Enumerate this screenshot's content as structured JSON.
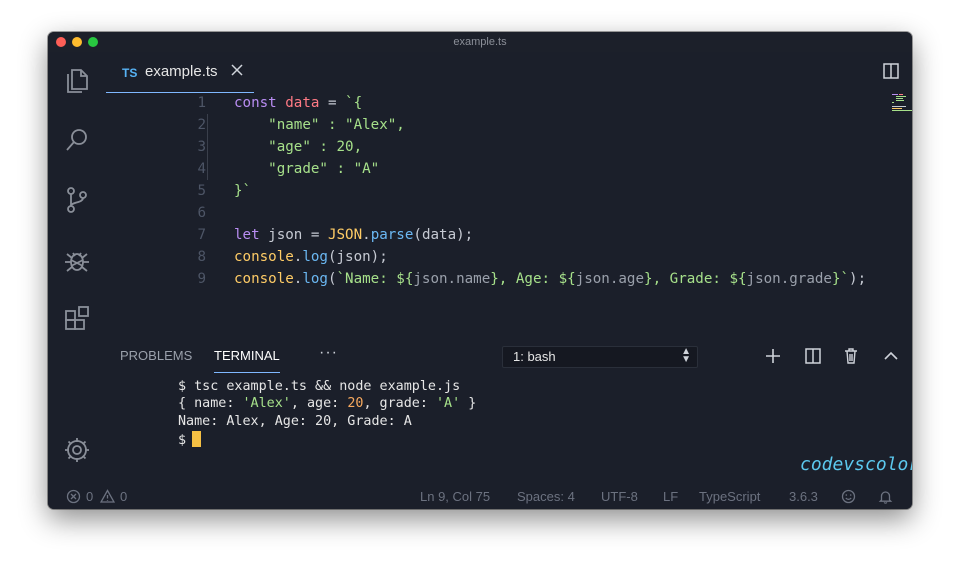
{
  "window": {
    "title": "example.ts"
  },
  "activity_bar": {
    "items": [
      "files-icon",
      "search-icon",
      "source-control-icon",
      "debug-icon",
      "extensions-icon"
    ],
    "bottom": "gear-icon"
  },
  "tab": {
    "lang_badge": "TS",
    "filename": "example.ts"
  },
  "editor": {
    "lines": [
      {
        "num": "1",
        "tokens": [
          [
            "kw",
            "const "
          ],
          [
            "var",
            "data"
          ],
          [
            "punc",
            " = "
          ],
          [
            "tpl",
            "`{"
          ]
        ]
      },
      {
        "num": "2",
        "tokens": [
          [
            "str",
            "    \"name\" : \"Alex\","
          ]
        ]
      },
      {
        "num": "3",
        "tokens": [
          [
            "str",
            "    \"age\" : 20,"
          ]
        ]
      },
      {
        "num": "4",
        "tokens": [
          [
            "str",
            "    \"grade\" : \"A\""
          ]
        ]
      },
      {
        "num": "5",
        "tokens": [
          [
            "tpl",
            "}`"
          ]
        ]
      },
      {
        "num": "6",
        "tokens": []
      },
      {
        "num": "7",
        "tokens": [
          [
            "kw",
            "let "
          ],
          [
            "punc",
            "json = "
          ],
          [
            "obj",
            "JSON"
          ],
          [
            "punc",
            "."
          ],
          [
            "fn",
            "parse"
          ],
          [
            "punc",
            "(data);"
          ]
        ]
      },
      {
        "num": "8",
        "tokens": [
          [
            "obj",
            "console"
          ],
          [
            "punc",
            "."
          ],
          [
            "fn",
            "log"
          ],
          [
            "punc",
            "(json);"
          ]
        ]
      },
      {
        "num": "9",
        "tokens": [
          [
            "obj",
            "console"
          ],
          [
            "punc",
            "."
          ],
          [
            "fn",
            "log"
          ],
          [
            "punc",
            "("
          ],
          [
            "tpl",
            "`Name: ${"
          ],
          [
            "interp",
            "json.name"
          ],
          [
            "tpl",
            "}, Age: ${"
          ],
          [
            "interp",
            "json.age"
          ],
          [
            "tpl",
            "}, Grade: ${"
          ],
          [
            "interp",
            "json.grade"
          ],
          [
            "tpl",
            "}`"
          ],
          [
            "punc",
            ");"
          ]
        ]
      }
    ]
  },
  "panel": {
    "tabs": [
      "PROBLEMS",
      "TERMINAL"
    ],
    "active_tab": "TERMINAL",
    "more": "···",
    "shell_select": "1: bash",
    "terminal": {
      "line1": "$ tsc example.ts && node example.js",
      "line2_parts": [
        [
          "plain",
          "{ name: "
        ],
        [
          "str",
          "'Alex'"
        ],
        [
          "plain",
          ", age: "
        ],
        [
          "num",
          "20"
        ],
        [
          "plain",
          ", grade: "
        ],
        [
          "str",
          "'A'"
        ],
        [
          "plain",
          " }"
        ]
      ],
      "line3": "Name: Alex, Age: 20, Grade: A",
      "prompt": "$"
    },
    "watermark": "codevscolor.com"
  },
  "status_bar": {
    "errors": "0",
    "warnings": "0",
    "position": "Ln 9, Col 75",
    "spaces": "Spaces: 4",
    "encoding": "UTF-8",
    "eol": "LF",
    "language": "TypeScript",
    "version": "3.6.3"
  },
  "colors": {
    "background": "#1b1f2a",
    "accent": "#7fb8ff",
    "cursor": "#f5c044"
  }
}
